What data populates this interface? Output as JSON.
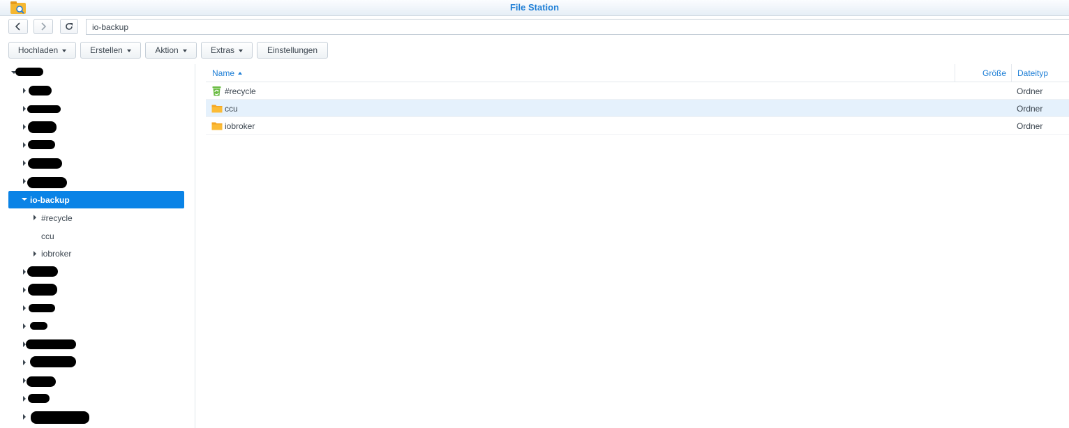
{
  "window": {
    "title": "File Station",
    "icon": "file-station-icon"
  },
  "address_bar": {
    "back_icon": "chevron-left-icon",
    "forward_icon": "chevron-right-icon",
    "refresh_icon": "refresh-icon",
    "path": "io-backup"
  },
  "toolbar": {
    "upload_label": "Hochladen",
    "create_label": "Erstellen",
    "action_label": "Aktion",
    "extras_label": "Extras",
    "settings_label": "Einstellungen"
  },
  "tree": {
    "selected_label": "io-backup",
    "children": [
      {
        "label": "#recycle",
        "expandable": true
      },
      {
        "label": "ccu",
        "expandable": false
      },
      {
        "label": "iobroker",
        "expandable": true
      }
    ]
  },
  "file_list": {
    "columns": {
      "name": "Name",
      "size": "Größe",
      "type": "Dateityp"
    },
    "sort": "name-ascending",
    "rows": [
      {
        "name": "#recycle",
        "size": "",
        "type": "Ordner",
        "icon": "recycle-bin-icon",
        "selected": false
      },
      {
        "name": "ccu",
        "size": "",
        "type": "Ordner",
        "icon": "folder-icon",
        "selected": true
      },
      {
        "name": "iobroker",
        "size": "",
        "type": "Ordner",
        "icon": "folder-icon",
        "selected": false
      }
    ]
  },
  "colors": {
    "accent": "#1f7fd6",
    "selection": "#0a83e6",
    "row_selected": "#e5f1fc",
    "folder": "#f5a623",
    "recycle": "#6cbd45"
  }
}
